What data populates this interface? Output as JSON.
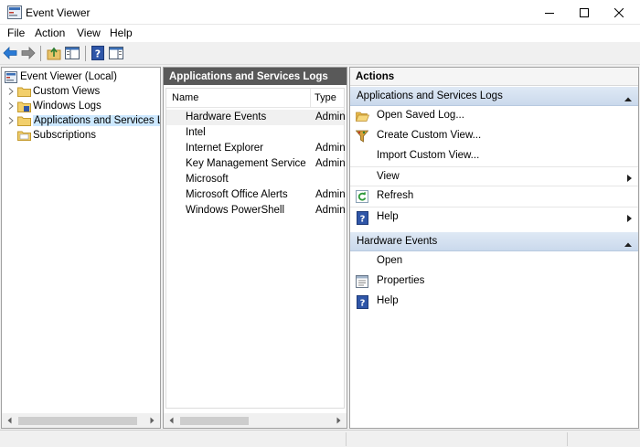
{
  "window": {
    "title": "Event Viewer"
  },
  "menu": [
    "File",
    "Action",
    "View",
    "Help"
  ],
  "toolbar": {
    "buttons": [
      "back-arrow-icon",
      "forward-arrow-icon",
      "up-folder-icon",
      "show-hide-tree-icon",
      "help-icon",
      "show-hide-action-pane-icon"
    ]
  },
  "tree": {
    "root": "Event Viewer (Local)",
    "items": [
      {
        "label": "Custom Views",
        "icon": "folder-icon",
        "expandable": true
      },
      {
        "label": "Windows Logs",
        "icon": "windows-logs-icon",
        "expandable": true
      },
      {
        "label": "Applications and Services Lo",
        "icon": "folder-icon",
        "expandable": true,
        "selected": true
      },
      {
        "label": "Subscriptions",
        "icon": "subscriptions-icon",
        "expandable": false
      }
    ]
  },
  "list": {
    "header": "Applications and Services Logs",
    "columns": [
      "Name",
      "Type"
    ],
    "rows": [
      {
        "name": "Hardware Events",
        "type": "Admin",
        "highlighted": true
      },
      {
        "name": "Intel",
        "type": ""
      },
      {
        "name": "Internet Explorer",
        "type": "Admin"
      },
      {
        "name": "Key Management Service",
        "type": "Admin"
      },
      {
        "name": "Microsoft",
        "type": ""
      },
      {
        "name": "Microsoft Office Alerts",
        "type": "Admin"
      },
      {
        "name": "Windows PowerShell",
        "type": "Admin"
      }
    ]
  },
  "actions": {
    "header": "Actions",
    "sections": [
      {
        "title": "Applications and Services Logs",
        "items": [
          {
            "label": "Open Saved Log...",
            "icon": "open-folder-icon"
          },
          {
            "label": "Create Custom View...",
            "icon": "filter-icon"
          },
          {
            "label": "Import Custom View...",
            "icon": ""
          },
          {
            "label": "View",
            "icon": "",
            "submenu": true
          },
          {
            "label": "Refresh",
            "icon": "refresh-icon"
          },
          {
            "label": "Help",
            "icon": "help-icon",
            "submenu": true
          }
        ]
      },
      {
        "title": "Hardware Events",
        "items": [
          {
            "label": "Open",
            "icon": ""
          },
          {
            "label": "Properties",
            "icon": "properties-icon"
          },
          {
            "label": "Help",
            "icon": "help-icon"
          }
        ]
      }
    ]
  },
  "colors": {
    "selection": "#cce8ff",
    "list_header_bg": "#595959",
    "section_bg": "#cad9ec",
    "accent_blue": "#1e5aa8"
  }
}
